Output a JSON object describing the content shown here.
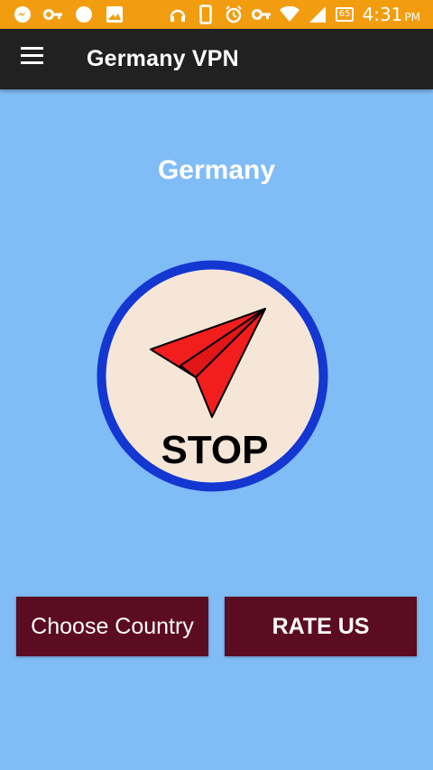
{
  "status_bar": {
    "icons": [
      "messenger-icon",
      "vpn-key-icon",
      "circle-icon",
      "image-icon",
      "headset-icon",
      "phone-icon",
      "alarm-icon",
      "vpn-key-icon",
      "wifi-icon",
      "signal-icon"
    ],
    "battery": "65",
    "time": "4:31",
    "ampm": "PM"
  },
  "app_bar": {
    "menu_icon": "hamburger-menu-icon",
    "title": "Germany VPN"
  },
  "main": {
    "country": "Germany",
    "toggle": {
      "label": "STOP",
      "icon": "paper-plane-icon",
      "ring_color": "#1437d2",
      "fill_color": "#f5e6d8",
      "plane_color": "#f21d1d"
    },
    "choose_country_label": "Choose Country",
    "rate_us_label": "RATE US"
  },
  "colors": {
    "status_bar": "#f29d10",
    "app_bar": "#212121",
    "background": "#80bcf6",
    "button": "#5c0c21"
  }
}
